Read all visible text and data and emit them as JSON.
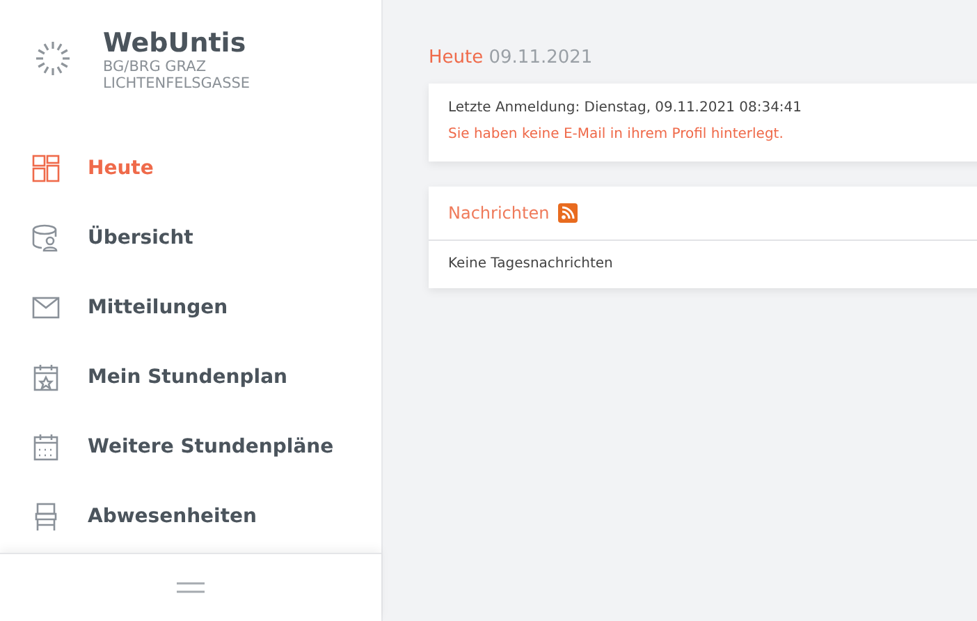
{
  "brand": {
    "title": "WebUntis",
    "school": [
      "BG/BRG GRAZ",
      "LICHTENFELSGASSE"
    ]
  },
  "sidebar": {
    "items": [
      {
        "label": "Heute",
        "selected": true
      },
      {
        "label": "Übersicht",
        "selected": false
      },
      {
        "label": "Mitteilungen",
        "selected": false
      },
      {
        "label": "Mein Stundenplan",
        "selected": false
      },
      {
        "label": "Weitere Stundenpläne",
        "selected": false
      },
      {
        "label": "Abwesenheiten",
        "selected": false
      }
    ]
  },
  "page": {
    "title": "Heute",
    "date": "09.11.2021"
  },
  "login_card": {
    "last_login": "Letzte Anmeldung: Dienstag, 09.11.2021 08:34:41",
    "warning": "Sie haben keine E-Mail in ihrem Profil hinterlegt."
  },
  "news_card": {
    "title": "Nachrichten",
    "body": "Keine Tagesnachrichten"
  }
}
